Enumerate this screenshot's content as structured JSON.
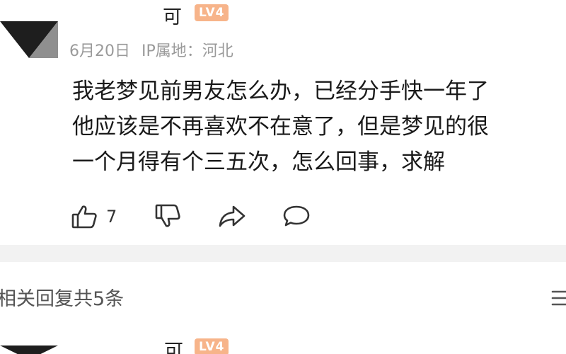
{
  "comment": {
    "username_fragment": "可",
    "level_badge": "LV4",
    "date": "6月20日",
    "ip_location": "IP属地：河北",
    "text_lines": [
      "我老梦见前男友怎么办，已经分手快一年了",
      "他应该是不再喜欢不在意了，但是梦见的很",
      "一个月得有个三五次，怎么回事，求解"
    ],
    "like_count": "7",
    "icons": {
      "like": "thumbs-up-icon",
      "dislike": "thumbs-down-icon",
      "share": "share-icon",
      "comment": "comment-bubble-icon"
    }
  },
  "replies": {
    "header": "相关回复共5条",
    "sort_icon": "menu-lines-icon"
  },
  "next_comment": {
    "username_fragment": "可",
    "level_badge": "LV4"
  },
  "colors": {
    "badge": "#f7b48a",
    "meta_text": "#9a9a9a",
    "divider": "#f2f2f2",
    "icon": "#333333"
  }
}
